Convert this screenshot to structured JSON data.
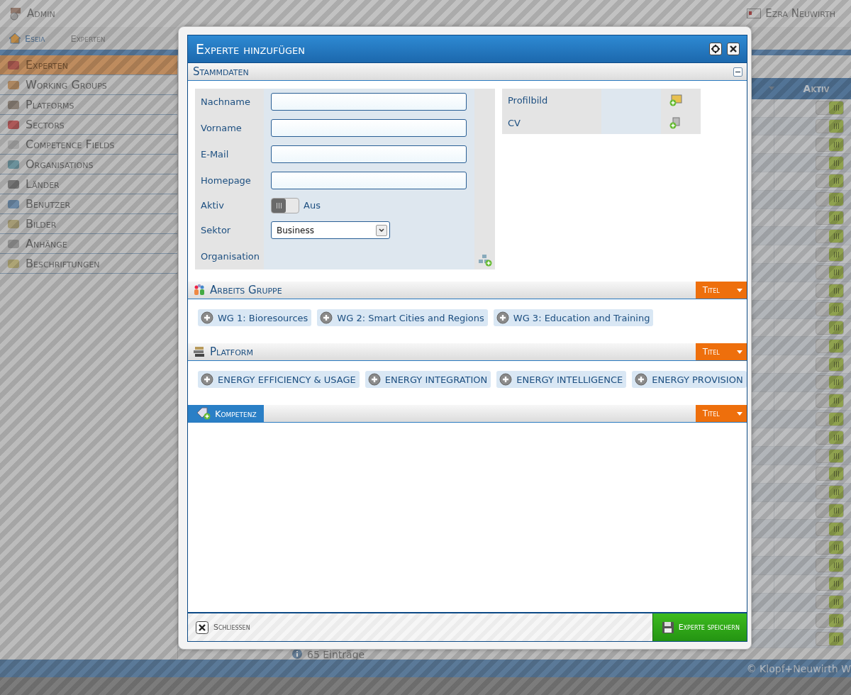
{
  "header": {
    "title": "Admin",
    "user": "Ezra Neuwirth"
  },
  "breadcrumb": [
    "Eseia",
    "Experten"
  ],
  "sidebar": {
    "items": [
      {
        "label": "Experten",
        "selected": true
      },
      {
        "label": "Working Groups",
        "selected": false
      },
      {
        "label": "Platforms",
        "selected": false
      },
      {
        "label": "Sectors",
        "selected": false
      },
      {
        "label": "Competence Fields",
        "selected": false
      },
      {
        "label": "Organisations",
        "selected": false
      },
      {
        "label": "Länder",
        "selected": false
      },
      {
        "label": "Benutzer",
        "selected": false
      },
      {
        "label": "Bilder",
        "selected": false
      },
      {
        "label": "Anhänge",
        "selected": false
      },
      {
        "label": "Beschriftungen",
        "selected": false
      }
    ]
  },
  "table": {
    "columns": [
      "Aktiv"
    ],
    "rows": [
      {
        "aktiv": true
      },
      {
        "aktiv": true
      },
      {
        "aktiv": true
      },
      {
        "aktiv": true
      },
      {
        "aktiv": true
      },
      {
        "aktiv": true
      },
      {
        "aktiv": true
      },
      {
        "aktiv": true
      },
      {
        "aktiv": true
      },
      {
        "aktiv": true
      },
      {
        "aktiv": true
      },
      {
        "aktiv": true
      },
      {
        "aktiv": true
      },
      {
        "aktiv": true
      },
      {
        "aktiv": true
      },
      {
        "aktiv": true
      },
      {
        "aktiv": true
      },
      {
        "aktiv": true
      },
      {
        "aktiv": true
      },
      {
        "aktiv": true
      },
      {
        "aktiv": true
      },
      {
        "aktiv": true
      },
      {
        "aktiv": true
      },
      {
        "aktiv": true
      },
      {
        "aktiv": true
      },
      {
        "aktiv": true
      },
      {
        "aktiv": true
      },
      {
        "aktiv": true
      },
      {
        "aktiv": true
      },
      {
        "aktiv": true
      }
    ]
  },
  "pager": {
    "info": "65 Einträge"
  },
  "footer": {
    "copyright": "© Klopf+Neuwirth W"
  },
  "dialog": {
    "title": "Experte hinzufügen",
    "stammdaten": {
      "title": "Stammdaten",
      "expanded": true,
      "fields": [
        {
          "label": "Nachname",
          "kind": "text"
        },
        {
          "label": "Vorname",
          "kind": "text"
        },
        {
          "label": "E-Mail",
          "kind": "text"
        },
        {
          "label": "Homepage",
          "kind": "text"
        },
        {
          "label": "Aktiv",
          "kind": "toggle",
          "on": false,
          "state_label": "Aus"
        },
        {
          "label": "Sektor",
          "kind": "select",
          "value": "Business"
        },
        {
          "label": "Organisation",
          "kind": "picker"
        }
      ],
      "files": [
        {
          "label": "Profilbild"
        },
        {
          "label": "CV"
        }
      ]
    },
    "sections": [
      {
        "title": "Arbeits Gruppe",
        "kind": "plain",
        "sort_button": "Titel",
        "chips": [
          "WG 1: Bioresources",
          "WG 2: Smart Cities and Regions",
          "WG 3: Education and Training"
        ]
      },
      {
        "title": "Platform",
        "kind": "plain",
        "sort_button": "Titel",
        "chips": [
          "ENERGY EFFICIENCY & USAGE",
          "ENERGY INTEGRATION",
          "ENERGY INTELLIGENCE",
          "ENERGY PROVISION"
        ]
      },
      {
        "title": "Kompetenz",
        "kind": "tab",
        "sort_button": "Titel"
      }
    ],
    "close_button": "Schliessen",
    "save_button": "Experte speichern"
  }
}
